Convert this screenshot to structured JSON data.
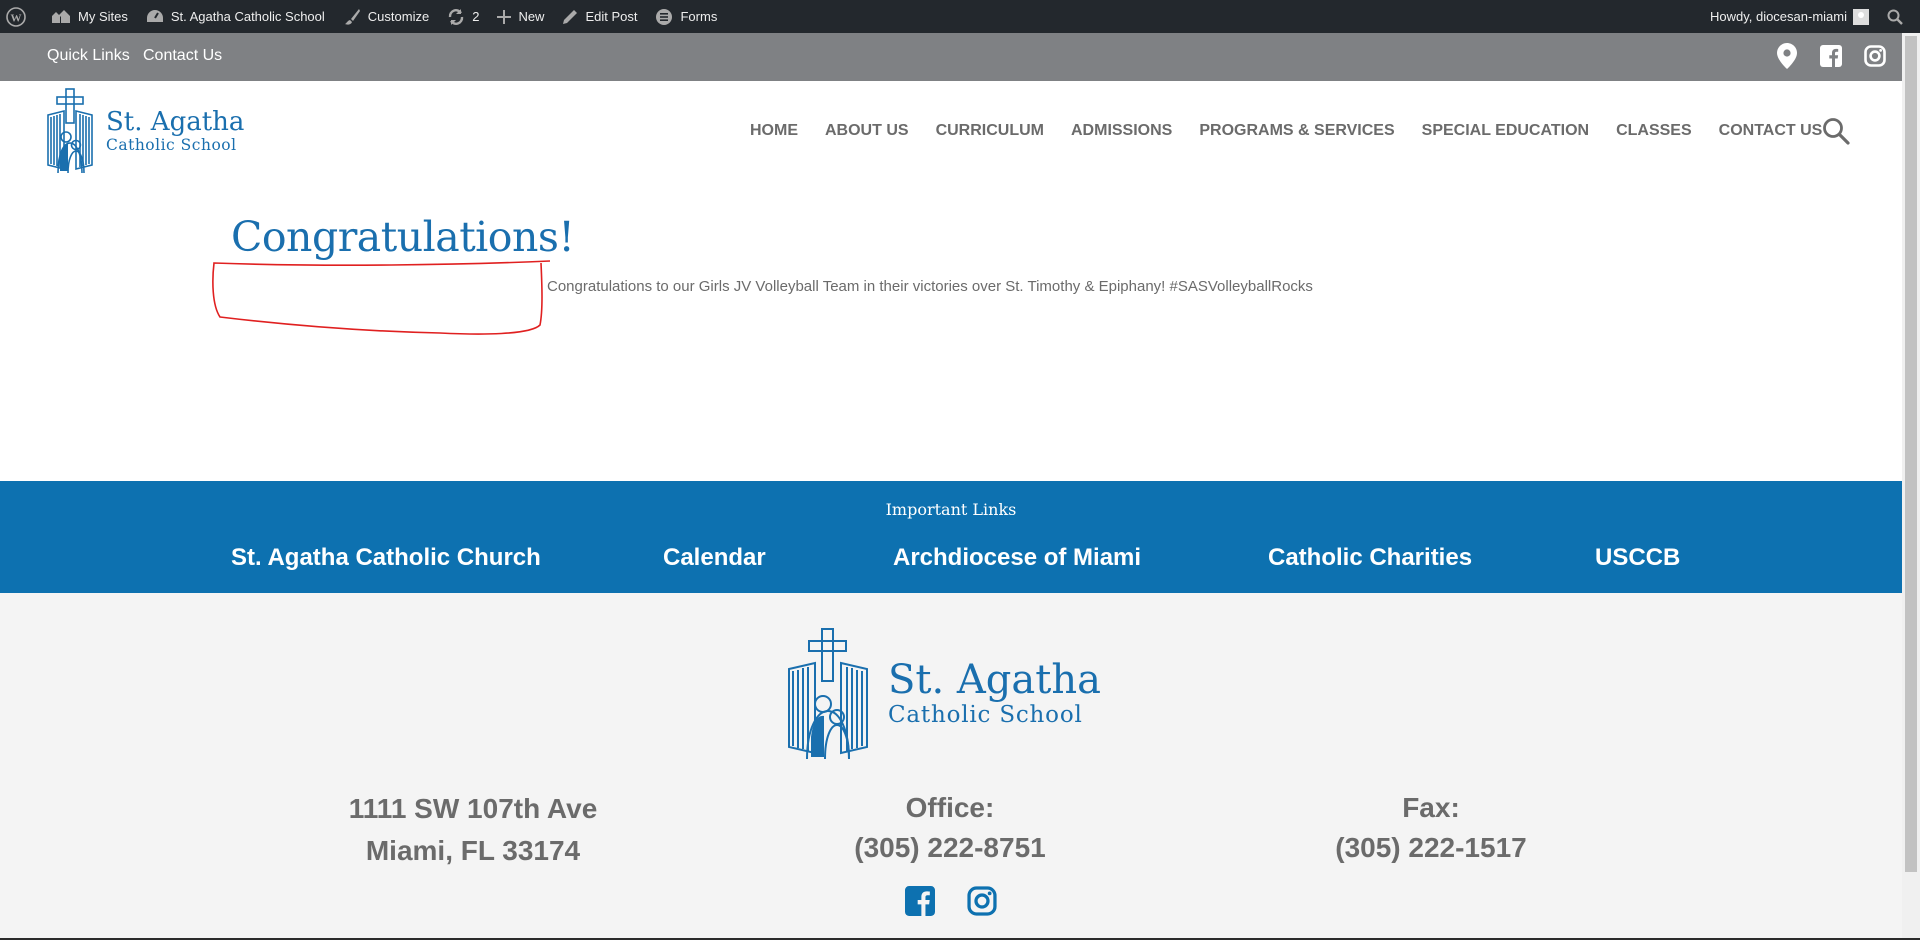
{
  "admin_bar": {
    "my_sites": "My Sites",
    "site_name": "St. Agatha Catholic School",
    "customize": "Customize",
    "updates_count": "2",
    "new": "New",
    "edit_post": "Edit Post",
    "forms": "Forms",
    "howdy": "Howdy, diocesan-miami"
  },
  "topbar": {
    "quick_links": "Quick Links",
    "contact_us": "Contact Us"
  },
  "logo": {
    "line1": "St. Agatha",
    "line2": "Catholic School"
  },
  "nav": {
    "items": [
      "HOME",
      "ABOUT US",
      "CURRICULUM",
      "ADMISSIONS",
      "PROGRAMS & SERVICES",
      "SPECIAL EDUCATION",
      "CLASSES",
      "CONTACT US"
    ]
  },
  "content": {
    "title": "Congratulations!",
    "body": "Congratulations to our Girls JV Volleyball Team in their victories over St. Timothy & Epiphany! #SASVolleyballRocks"
  },
  "important_links": {
    "heading": "Important Links",
    "links": [
      "St. Agatha Catholic Church",
      "Calendar",
      "Archdiocese of Miami",
      "Catholic Charities",
      "USCCB"
    ]
  },
  "footer": {
    "address_line1": "1111 SW 107th Ave",
    "address_line2": "Miami, FL 33174",
    "office_label": "Office:",
    "office_phone": "(305) 222-8751",
    "fax_label": "Fax:",
    "fax_phone": "(305) 222-1517"
  },
  "colors": {
    "brand_blue": "#0d71b0",
    "admin_bar": "#23282d",
    "topbar": "#7f8184",
    "annotation_red": "#e02020"
  },
  "icons": [
    "wordpress-icon",
    "my-sites-icon",
    "site-dashboard-icon",
    "customize-brush-icon",
    "updates-icon",
    "plus-icon",
    "edit-pencil-icon",
    "forms-icon",
    "admin-search-icon",
    "map-pin-icon",
    "facebook-icon",
    "instagram-icon",
    "search-icon"
  ]
}
